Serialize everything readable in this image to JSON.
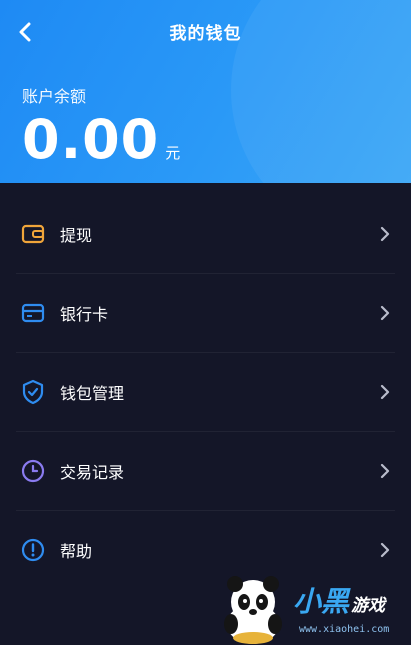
{
  "header": {
    "title": "我的钱包",
    "balance_label": "账户余额",
    "balance_amount": "0.00",
    "balance_unit": "元"
  },
  "menu": {
    "items": [
      {
        "label": "提现",
        "icon": "wallet-icon",
        "icon_color": "#f0a53a"
      },
      {
        "label": "银行卡",
        "icon": "bank-card-icon",
        "icon_color": "#2f8cf0"
      },
      {
        "label": "钱包管理",
        "icon": "shield-check-icon",
        "icon_color": "#2f8cf0"
      },
      {
        "label": "交易记录",
        "icon": "clock-icon",
        "icon_color": "#8a7bf0"
      },
      {
        "label": "帮助",
        "icon": "info-icon",
        "icon_color": "#2f8cf0"
      }
    ]
  },
  "watermark": {
    "brand_main": "小黑",
    "brand_sub": "游戏",
    "url": "www.xiaohei.com"
  },
  "colors": {
    "header_bg": "#1e8af4",
    "page_bg": "#141628"
  }
}
